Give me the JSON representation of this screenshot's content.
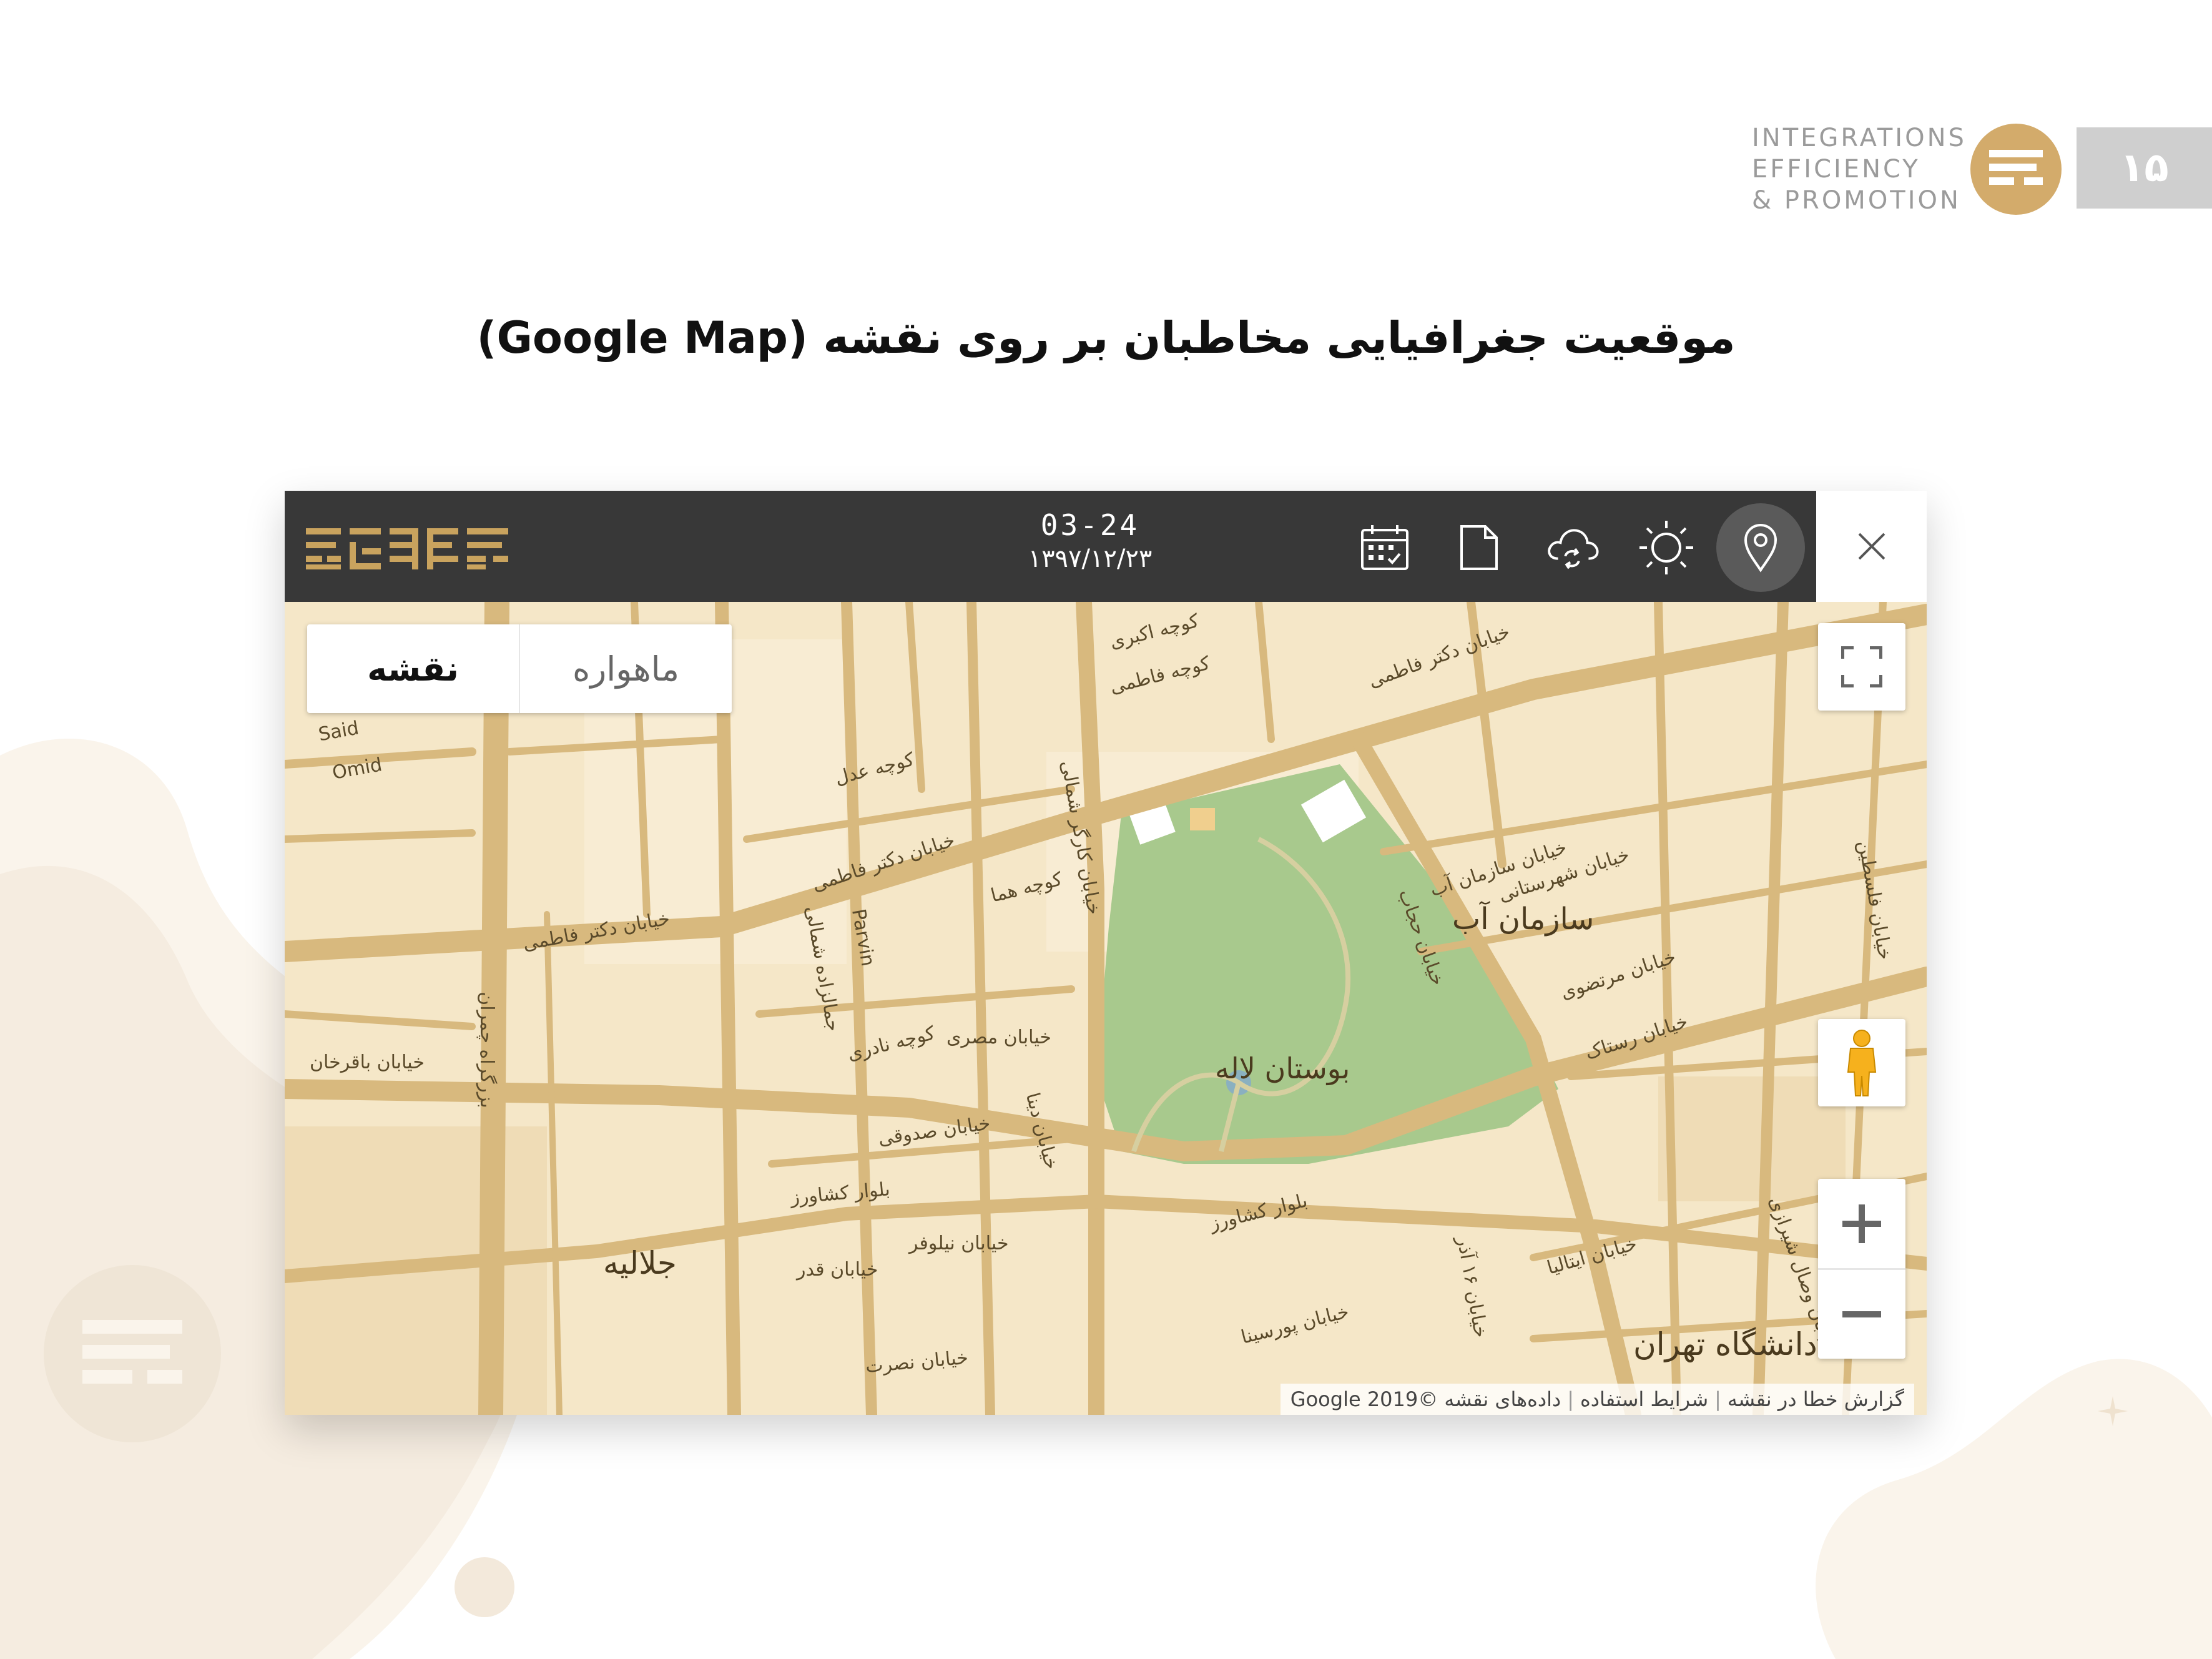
{
  "header": {
    "brand_lines": [
      "INTEGRATIONS",
      "EFFICIENCY",
      "& PROMOTION"
    ],
    "page_number": "۱۵"
  },
  "page_title": "موقعیت جغرافیایی مخاطبان بر روی نقشه (Google Map)",
  "app": {
    "clock_time": "03-24",
    "clock_date": "۱۳۹۷/۱۲/۲۳",
    "toolbar_icons": [
      "calendar-icon",
      "document-icon",
      "cloud-sync-icon",
      "sun-icon",
      "location-pin-icon",
      "close-icon"
    ]
  },
  "map": {
    "map_type_map": "نقشه",
    "map_type_satellite": "ماهواره",
    "areas": {
      "park": "بوستان لاله",
      "water_org": "سازمان آب",
      "jalalieh": "جلالیه",
      "university": "دانشگاه تهران"
    },
    "streets": [
      "خیابان دکتر فاطمی",
      "خیابان دکتر فاطمی",
      "خیابان دکتر فاطمی",
      "خیابان کارگر شمالی",
      "بلوار کشاورز",
      "بلوار کشاورز",
      "خیابان ۱۶ آذر",
      "خیابان حجاب",
      "خیابان مصری",
      "خیابان صدوقی",
      "خیابان نیلوفر",
      "خیابان قدر",
      "خیابان نصرت",
      "بزرگراه چمران",
      "خیابان سازمان آب",
      "خیابان شهرستانی",
      "خیابان مرتضوی",
      "خیابان رستاک",
      "خیابان ایتالیا",
      "خیابان پورسینا",
      "خیابان وصال شیرازی",
      "خیابان فلسطین",
      "خیابان باقرخان",
      "کوچه اکبری",
      "کوچه فاطمی",
      "کوچه عدل",
      "کوچه هما",
      "کوچه نادری",
      "جمالزاده شمالی",
      "خیابان دینا",
      "Parvin",
      "Omid",
      "Said"
    ],
    "attribution": {
      "report": "گزارش خطا در نقشه",
      "terms": "شرایط استفاده",
      "data": "داده‌های نقشه ©2019 Google"
    },
    "controls": [
      "fullscreen-button",
      "street-view-pegman",
      "zoom-in-button",
      "zoom-out-button"
    ]
  },
  "colors": {
    "accent_gold": "#d3ab6b",
    "titlebar": "#383838",
    "map_bg": "#f5e7c8",
    "road": "#d8b97e",
    "park": "#a8c98d"
  }
}
